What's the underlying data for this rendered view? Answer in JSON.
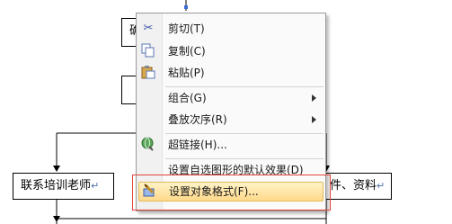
{
  "flowchart": {
    "box_top_partial": "确",
    "box_left": "联系培训老师",
    "box_right_partial": "件、资料",
    "paragraph_mark": "↵"
  },
  "context_menu": {
    "items": [
      {
        "label": "剪切(T)",
        "icon": "scissors-icon"
      },
      {
        "label": "复制(C)",
        "icon": "copy-icon"
      },
      {
        "label": "粘贴(P)",
        "icon": "paste-icon"
      },
      {
        "label": "组合(G)",
        "icon": "",
        "submenu": true
      },
      {
        "label": "叠放次序(R)",
        "icon": "",
        "submenu": true
      },
      {
        "label": "超链接(H)...",
        "icon": "hyperlink-globe-icon"
      },
      {
        "label": "设置自选图形的默认效果(D)",
        "icon": ""
      },
      {
        "label": "设置对象格式(F)...",
        "icon": "format-object-icon",
        "highlighted": true
      }
    ]
  },
  "colors": {
    "highlight_top": "#fff3c7",
    "highlight_bottom": "#ffd98a",
    "annotation_frame": "#e0453a"
  }
}
